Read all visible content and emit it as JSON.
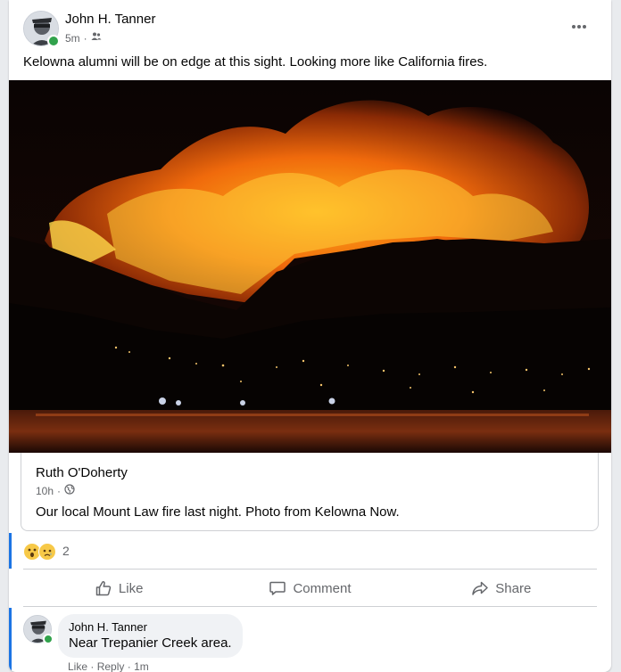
{
  "post": {
    "author": "John H. Tanner",
    "time": "5m",
    "audience_icon": "friends-icon",
    "text": "Kelowna alumni will be on edge at this sight. Looking more like California fires."
  },
  "shared": {
    "author": "Ruth O'Doherty",
    "time": "10h",
    "audience_icon": "globe-icon",
    "text": "Our local Mount Law fire last night. Photo from Kelowna Now."
  },
  "reactions": {
    "icons": [
      "wow-emoji",
      "sad-emoji"
    ],
    "count": "2"
  },
  "actions": {
    "like": "Like",
    "comment": "Comment",
    "share": "Share"
  },
  "comment": {
    "author": "John H. Tanner",
    "text": "Near Trepanier Creek area.",
    "like": "Like",
    "separator": "·",
    "reply": "Reply",
    "time": "1m"
  },
  "colors": {
    "accent": "#1b74e4",
    "online": "#31a24c",
    "secondary_text": "#65676b"
  }
}
